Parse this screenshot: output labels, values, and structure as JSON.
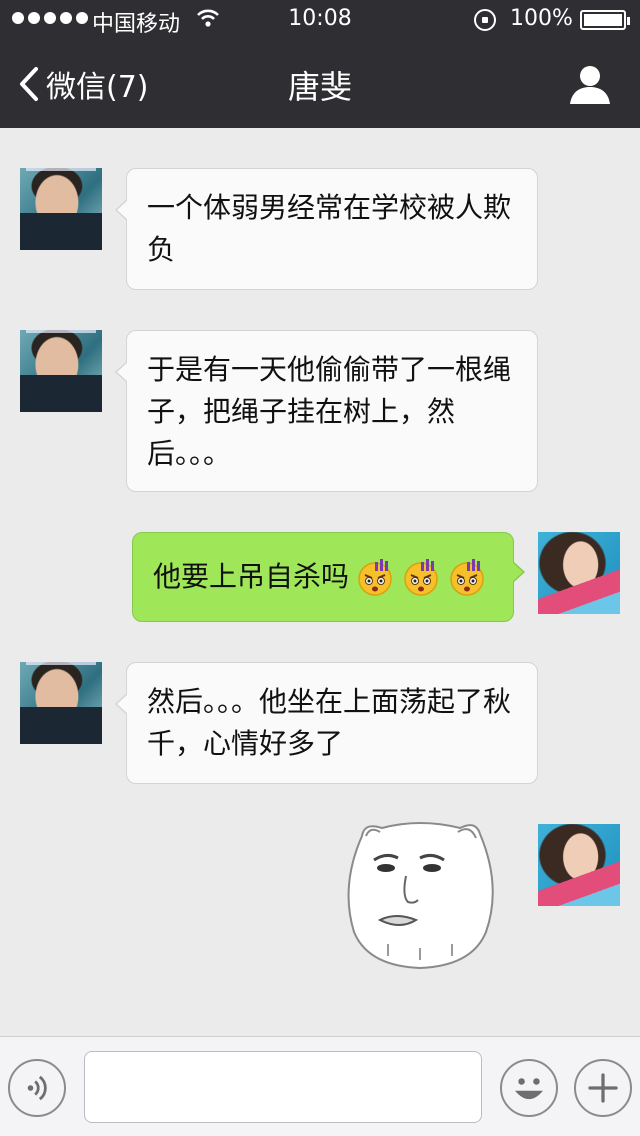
{
  "status_bar": {
    "carrier": "中国移动",
    "time": "10:08",
    "battery": "100%",
    "icons": [
      "signal-dots-icon",
      "wifi-icon",
      "rotation-lock-icon",
      "battery-icon"
    ]
  },
  "nav": {
    "back_label": "微信(7)",
    "title": "唐斐",
    "icons": [
      "chevron-left-icon",
      "person-icon"
    ]
  },
  "messages": [
    {
      "side": "incoming",
      "text": "一个体弱男经常在学校被人欺负"
    },
    {
      "side": "incoming",
      "text": "于是有一天他偷偷带了一根绳子，把绳子挂在树上，然后。。。"
    },
    {
      "side": "outgoing",
      "text": "他要上吊自杀吗",
      "emoji_count": 3,
      "emoji": "angry-face-emoji"
    },
    {
      "side": "incoming",
      "text": "然后。。。他坐在上面荡起了秋千，心情好多了"
    },
    {
      "side": "outgoing",
      "sticker": "cat-face-sticker"
    }
  ],
  "input_bar": {
    "text_value": "",
    "icons": [
      "voice-icon",
      "smiley-icon",
      "plus-icon"
    ]
  },
  "colors": {
    "nav_bg": "#2f2f33",
    "chat_bg": "#ebebeb",
    "incoming_bubble": "#fafafa",
    "outgoing_bubble": "#9fe658"
  }
}
